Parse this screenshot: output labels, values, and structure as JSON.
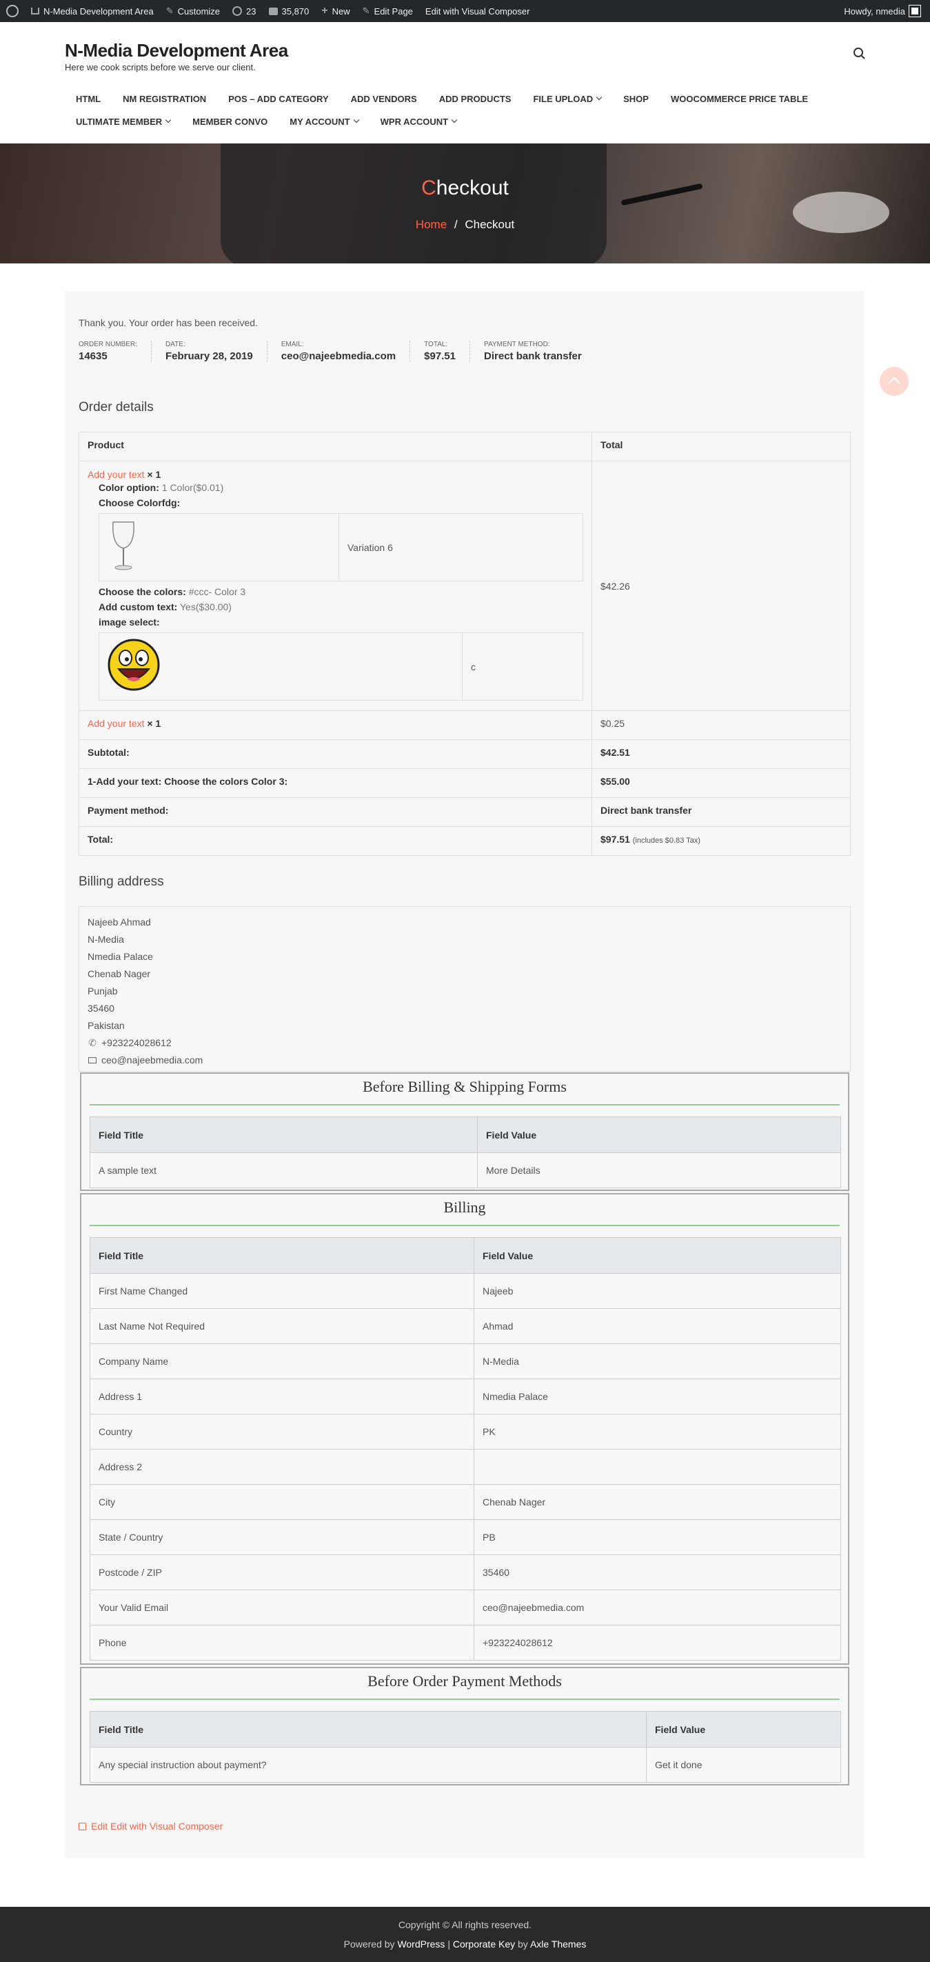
{
  "adminbar": {
    "site_name": "N-Media Development Area",
    "customize": "Customize",
    "updates": "23",
    "comments": "35,870",
    "new": "New",
    "edit_page": "Edit Page",
    "edit_vc": "Edit with Visual Composer",
    "howdy": "Howdy, nmedia"
  },
  "site": {
    "title": "N-Media Development Area",
    "description": "Here we cook scripts before we serve our client."
  },
  "nav": {
    "row1": [
      {
        "label": "HTML"
      },
      {
        "label": "NM REGISTRATION"
      },
      {
        "label": "POS – ADD CATEGORY"
      },
      {
        "label": "ADD VENDORS"
      },
      {
        "label": "ADD PRODUCTS"
      },
      {
        "label": "FILE UPLOAD"
      },
      {
        "label": "SHOP"
      },
      {
        "label": "WOOCOMMERCE PRICE TABLE"
      }
    ],
    "row2": [
      {
        "label": "ULTIMATE MEMBER"
      },
      {
        "label": "MEMBER CONVO"
      },
      {
        "label": "MY ACCOUNT"
      },
      {
        "label": "WPR ACCOUNT"
      }
    ]
  },
  "hero": {
    "title_first": "C",
    "title_rest": "heckout",
    "crumb_home": "Home",
    "crumb_sep": "/",
    "crumb_current": "Checkout"
  },
  "order": {
    "thanks": "Thank you. Your order has been received.",
    "overview": [
      {
        "label": "ORDER NUMBER:",
        "value": "14635"
      },
      {
        "label": "DATE:",
        "value": "February 28, 2019"
      },
      {
        "label": "EMAIL:",
        "value": "ceo@najeebmedia.com"
      },
      {
        "label": "TOTAL:",
        "value": "$97.51"
      },
      {
        "label": "PAYMENT METHOD:",
        "value": "Direct bank transfer"
      }
    ],
    "details_heading": "Order details",
    "col_product": "Product",
    "col_total": "Total",
    "item1": {
      "name": "Add your text",
      "qty": "× 1",
      "color_option_label": "Color option:",
      "color_option_value": "1 Color($0.01)",
      "choose_colorfdg": "Choose Colorfdg:",
      "variation": "Variation 6",
      "choose_colors_label": "Choose the colors:",
      "choose_colors_value": "#ccc- Color 3",
      "custom_text_label": "Add custom text:",
      "custom_text_value": "Yes($30.00)",
      "image_select_label": "image select:",
      "image_select_value": "c",
      "total": "$42.26"
    },
    "item2": {
      "name": "Add your text",
      "qty": "× 1",
      "total": "$0.25"
    },
    "subtotal_label": "Subtotal:",
    "subtotal": "$42.51",
    "fee_label": "1-Add your text: Choose the colors Color 3:",
    "fee": "$55.00",
    "payment_label": "Payment method:",
    "payment": "Direct bank transfer",
    "total_label": "Total:",
    "total": "$97.51",
    "tax_note": "(includes $0.83 Tax)"
  },
  "billing": {
    "heading": "Billing address",
    "lines": [
      "Najeeb Ahmad",
      "N-Media",
      "Nmedia Palace",
      "Chenab Nager",
      "Punjab",
      "35460",
      "Pakistan"
    ],
    "phone": "+923224028612",
    "email": "ceo@najeebmedia.com"
  },
  "sections": {
    "before_billing": {
      "title": "Before Billing & Shipping Forms",
      "h1": "Field Title",
      "h2": "Field Value",
      "rows": [
        [
          "A sample text",
          "More Details"
        ]
      ]
    },
    "billing": {
      "title": "Billing",
      "h1": "Field Title",
      "h2": "Field Value",
      "rows": [
        [
          "First Name Changed",
          "Najeeb"
        ],
        [
          "Last Name Not Required",
          "Ahmad"
        ],
        [
          "Company Name",
          "N-Media"
        ],
        [
          "Address 1",
          "Nmedia Palace"
        ],
        [
          "Country",
          "PK"
        ],
        [
          "Address 2",
          ""
        ],
        [
          "City",
          "Chenab Nager"
        ],
        [
          "State / Country",
          "PB"
        ],
        [
          "Postcode / ZIP",
          "35460"
        ],
        [
          "Your Valid Email",
          "ceo@najeebmedia.com"
        ],
        [
          "Phone",
          "+923224028612"
        ]
      ]
    },
    "payment": {
      "title": "Before Order Payment Methods",
      "h1": "Field Title",
      "h2": "Field Value",
      "rows": [
        [
          "Any special instruction about payment?",
          "Get it done"
        ]
      ]
    }
  },
  "edit_vc_link": "Edit Edit with Visual Composer",
  "footer": {
    "copyright": "Copyright © All rights reserved.",
    "powered_prefix": "Powered by",
    "powered_wp": "WordPress",
    "sep": "|",
    "theme": "Corporate Key",
    "by": "by",
    "author": "Axle Themes"
  },
  "colors": {
    "accent": "#ff6347",
    "adminbar": "#23282d",
    "footer": "#2a2a2a",
    "section_line": "#4caf50"
  }
}
